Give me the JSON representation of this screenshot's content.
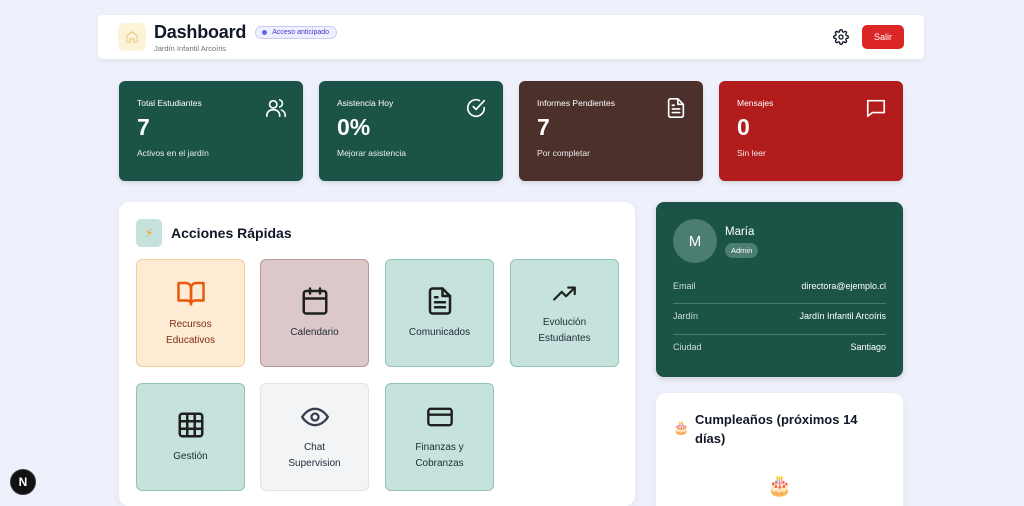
{
  "header": {
    "title": "Dashboard",
    "badge": "Acceso anticipado",
    "subtitle": "Jardín Infantil Arcoíris",
    "logout_label": "Salir"
  },
  "stats": [
    {
      "label": "Total Estudiantes",
      "value": "7",
      "sub": "Activos en el jardín",
      "color": "#1b5446",
      "icon": "users-icon"
    },
    {
      "label": "Asistencia Hoy",
      "value": "0%",
      "sub": "Mejorar asistencia",
      "color": "#1b5446",
      "icon": "check-circle-icon"
    },
    {
      "label": "Informes Pendientes",
      "value": "7",
      "sub": "Por completar",
      "color": "#4c302c",
      "icon": "document-icon"
    },
    {
      "label": "Mensajes",
      "value": "0",
      "sub": "Sin leer",
      "color": "#b31c1c",
      "icon": "message-icon"
    }
  ],
  "actions": {
    "title": "Acciones Rápidas",
    "tiles": [
      {
        "label": "Recursos Educativos",
        "icon": "book-icon"
      },
      {
        "label": "Calendario",
        "icon": "calendar-icon"
      },
      {
        "label": "Comunicados",
        "icon": "document-icon"
      },
      {
        "label": "Evolución Estudiantes",
        "icon": "trending-up-icon"
      },
      {
        "label": "Gestión",
        "icon": "grid-icon"
      },
      {
        "label": "Chat Supervision",
        "icon": "eye-icon"
      },
      {
        "label": "Finanzas y Cobranzas",
        "icon": "credit-card-icon"
      }
    ]
  },
  "profile": {
    "initial": "M",
    "name": "María",
    "role": "Admin",
    "rows": [
      {
        "key": "Email",
        "value": "directora@ejemplo.cl"
      },
      {
        "key": "Jardín",
        "value": "Jardín Infantil Arcoíris"
      },
      {
        "key": "Ciudad",
        "value": "Santiago"
      }
    ]
  },
  "birthdays": {
    "title": "Cumpleaños (próximos 14 días)"
  },
  "dev_badge": "N"
}
